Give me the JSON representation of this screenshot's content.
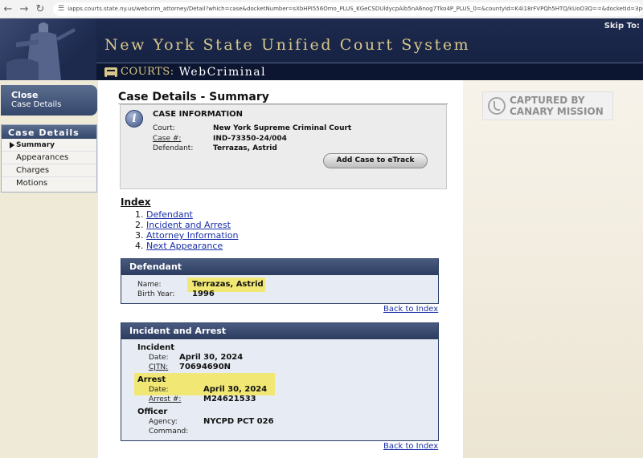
{
  "browser": {
    "url": "iapps.courts.state.ny.us/webcrim_attorney/Detail?which=case&docketNumber=sXbHPI556Omo_PLUS_KGeCSDUldycpAib5nA6nog7Tko4P_PLUS_0=&countyId=K4i18rFVPQh5HTQ/kUoO3Q==&docketId=3psWBNTp..."
  },
  "header": {
    "title": "New York State Unified Court System",
    "skip_to": "Skip To:",
    "sub_courts": "COURTS:",
    "sub_app": "WebCriminal"
  },
  "sidebar": {
    "close_title": "Close",
    "close_sub": "Case Details",
    "section_title": "Case Details",
    "items": [
      {
        "label": "Summary"
      },
      {
        "label": "Appearances"
      },
      {
        "label": "Charges"
      },
      {
        "label": "Motions"
      }
    ]
  },
  "main": {
    "page_title": "Case Details - Summary",
    "case_info": {
      "heading": "CASE INFORMATION",
      "court_label": "Court:",
      "court_value": "New York Supreme Criminal Court",
      "case_label": "Case #:",
      "case_value": "IND-73350-24/004",
      "defendant_label": "Defendant:",
      "defendant_value": "Terrazas, Astrid",
      "etrack_button": "Add Case to eTrack"
    },
    "index": {
      "title": "Index",
      "items": [
        {
          "num": "1.",
          "label": "Defendant"
        },
        {
          "num": "2.",
          "label": "Incident and Arrest"
        },
        {
          "num": "3.",
          "label": "Attorney Information"
        },
        {
          "num": "4.",
          "label": "Next Appearance"
        }
      ]
    },
    "defendant_panel": {
      "title": "Defendant",
      "name_label": "Name:",
      "name_value": "Terrazas, Astrid",
      "birth_label": "Birth Year:",
      "birth_value": "1996"
    },
    "incident_panel": {
      "title": "Incident and Arrest",
      "incident_heading": "Incident",
      "incident_date_label": "Date:",
      "incident_date_value": "April 30, 2024",
      "cjtn_label": "CJTN:",
      "cjtn_value": "70694690N",
      "arrest_heading": "Arrest",
      "arrest_date_label": "Date:",
      "arrest_date_value": "April 30, 2024",
      "arrest_num_label": "Arrest #:",
      "arrest_num_value": "M24621533",
      "officer_heading": "Officer",
      "agency_label": "Agency:",
      "agency_value": "NYCPD PCT 026",
      "command_label": "Command:"
    },
    "back_link": "Back to Index"
  },
  "watermark": {
    "line1": "CAPTURED BY",
    "line2": "CANARY MISSION"
  },
  "colors": {
    "header_navy": "#1d2a4e",
    "header_gold": "#d9c789",
    "highlight": "#f3e64a",
    "link_blue": "#1a2fa8"
  }
}
